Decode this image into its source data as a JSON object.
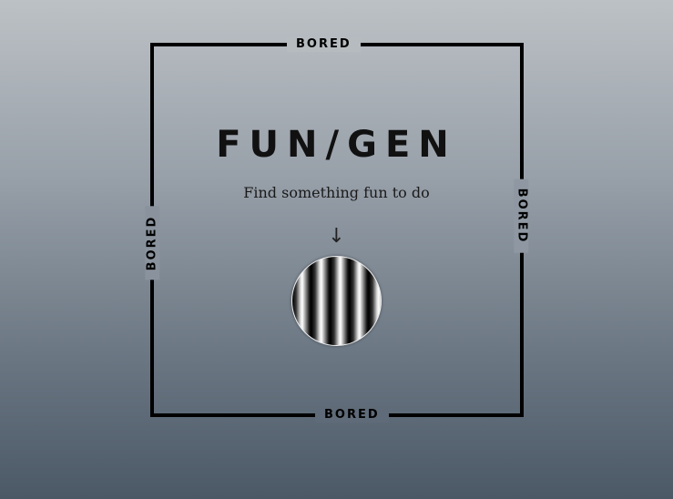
{
  "title": "FUN/GEN",
  "subtitle": "Find something fun to do",
  "arrow": "↓",
  "frame": {
    "top_label": "BORED",
    "bottom_label": "BORED",
    "left_label": "BORED",
    "right_label": "BORED"
  },
  "orb": {
    "icon": "striped-orb-icon"
  },
  "colors": {
    "background_top": "#bcc1c5",
    "background_bottom": "#4b5866",
    "frame": "#000000"
  }
}
